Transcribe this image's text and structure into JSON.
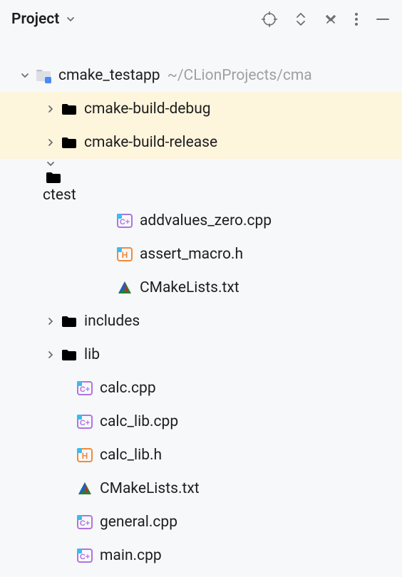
{
  "header": {
    "title": "Project"
  },
  "tree": {
    "root": {
      "label": "cmake_testapp",
      "path": "~/CLionProjects/cma"
    },
    "items": [
      {
        "label": "cmake-build-debug",
        "type": "folder-orange",
        "expand": "right",
        "indent": 1,
        "highlight": "orange"
      },
      {
        "label": "cmake-build-release",
        "type": "folder-orange",
        "expand": "right",
        "indent": 1,
        "highlight": "orange"
      },
      {
        "label": "ctest",
        "type": "folder-gray",
        "expand": "down",
        "indent": 1,
        "highlight": "selected"
      },
      {
        "label": "addvalues_zero.cpp",
        "type": "cpp",
        "indent": 2
      },
      {
        "label": "assert_macro.h",
        "type": "h",
        "indent": 2
      },
      {
        "label": "CMakeLists.txt",
        "type": "cmake",
        "indent": 2
      },
      {
        "label": "includes",
        "type": "folder-gray",
        "expand": "right",
        "indent": 1
      },
      {
        "label": "lib",
        "type": "folder-gray",
        "expand": "right",
        "indent": 1
      },
      {
        "label": "calc.cpp",
        "type": "cpp",
        "indent": 1
      },
      {
        "label": "calc_lib.cpp",
        "type": "cpp",
        "indent": 1
      },
      {
        "label": "calc_lib.h",
        "type": "h",
        "indent": 1
      },
      {
        "label": "CMakeLists.txt",
        "type": "cmake",
        "indent": 1
      },
      {
        "label": "general.cpp",
        "type": "cpp",
        "indent": 1
      },
      {
        "label": "main.cpp",
        "type": "cpp",
        "indent": 1
      }
    ]
  }
}
